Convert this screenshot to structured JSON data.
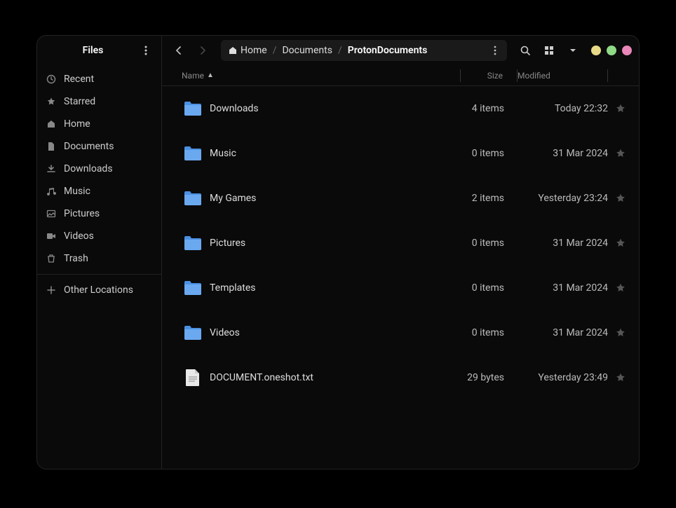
{
  "app_title": "Files",
  "breadcrumbs": [
    {
      "label": "Home",
      "has_icon": true
    },
    {
      "label": "Documents"
    },
    {
      "label": "ProtonDocuments",
      "current": true
    }
  ],
  "columns": {
    "name": "Name",
    "size": "Size",
    "modified": "Modified"
  },
  "sidebar": {
    "items": [
      {
        "icon": "clock",
        "label": "Recent"
      },
      {
        "icon": "star",
        "label": "Starred"
      },
      {
        "icon": "home",
        "label": "Home"
      },
      {
        "icon": "document",
        "label": "Documents"
      },
      {
        "icon": "download",
        "label": "Downloads"
      },
      {
        "icon": "music",
        "label": "Music"
      },
      {
        "icon": "picture",
        "label": "Pictures"
      },
      {
        "icon": "video",
        "label": "Videos"
      },
      {
        "icon": "trash",
        "label": "Trash"
      }
    ],
    "other_label": "Other Locations"
  },
  "files": [
    {
      "type": "folder",
      "name": "Downloads",
      "size": "4 items",
      "modified": "Today 22:32"
    },
    {
      "type": "folder",
      "name": "Music",
      "size": "0 items",
      "modified": "31 Mar 2024"
    },
    {
      "type": "folder",
      "name": "My Games",
      "size": "2 items",
      "modified": "Yesterday 23:24"
    },
    {
      "type": "folder",
      "name": "Pictures",
      "size": "0 items",
      "modified": "31 Mar 2024"
    },
    {
      "type": "folder",
      "name": "Templates",
      "size": "0 items",
      "modified": "31 Mar 2024"
    },
    {
      "type": "folder",
      "name": "Videos",
      "size": "0 items",
      "modified": "31 Mar 2024"
    },
    {
      "type": "text",
      "name": "DOCUMENT.oneshot.txt",
      "size": "29 bytes",
      "modified": "Yesterday 23:49"
    }
  ]
}
